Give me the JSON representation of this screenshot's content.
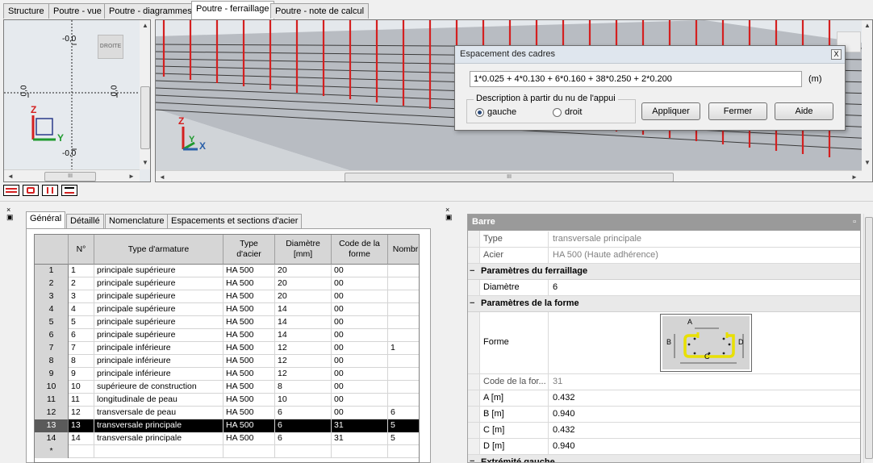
{
  "tabs": [
    "Structure",
    "Poutre - vue",
    "Poutre - diagrammes",
    "Poutre - ferraillage",
    "Poutre - note de calcul"
  ],
  "active_tab_index": 3,
  "left_view": {
    "view_cube_label": "DROITE",
    "scale_top": "-0,0",
    "scale_bottom": "-0,0",
    "scale_left": "0,0",
    "scale_right": "0,0",
    "axis_z": "Z",
    "axis_y": "Y"
  },
  "main_view": {
    "axis_z": "Z",
    "axis_y": "Y",
    "axis_x": "X"
  },
  "dialog": {
    "title": "Espacement des cadres",
    "close_label": "X",
    "formula": "1*0.025 + 4*0.130 + 6*0.160 + 38*0.250 + 2*0.200",
    "unit": "(m)",
    "group_label": "Description à partir du nu de l'appui",
    "radio_left": "gauche",
    "radio_right": "droit",
    "selected_radio": "gauche",
    "btn_apply": "Appliquer",
    "btn_close": "Fermer",
    "btn_help": "Aide"
  },
  "panel_tabs": [
    "Général",
    "Détaillé",
    "Nomenclature",
    "Espacements et sections d'acier"
  ],
  "grid": {
    "headers": [
      "N°",
      "Type d'armature",
      "Type\nd'acier",
      "Diamètre\n[mm]",
      "Code de la\nforme",
      "Nombr"
    ],
    "rows": [
      [
        "1",
        "1",
        "principale supérieure",
        "HA 500",
        "20",
        "00",
        ""
      ],
      [
        "2",
        "2",
        "principale supérieure",
        "HA 500",
        "20",
        "00",
        ""
      ],
      [
        "3",
        "3",
        "principale supérieure",
        "HA 500",
        "20",
        "00",
        ""
      ],
      [
        "4",
        "4",
        "principale supérieure",
        "HA 500",
        "14",
        "00",
        ""
      ],
      [
        "5",
        "5",
        "principale supérieure",
        "HA 500",
        "14",
        "00",
        ""
      ],
      [
        "6",
        "6",
        "principale supérieure",
        "HA 500",
        "14",
        "00",
        ""
      ],
      [
        "7",
        "7",
        "principale inférieure",
        "HA 500",
        "12",
        "00",
        "1"
      ],
      [
        "8",
        "8",
        "principale inférieure",
        "HA 500",
        "12",
        "00",
        ""
      ],
      [
        "9",
        "9",
        "principale inférieure",
        "HA 500",
        "12",
        "00",
        ""
      ],
      [
        "10",
        "10",
        "supérieure de construction",
        "HA 500",
        "8",
        "00",
        ""
      ],
      [
        "11",
        "11",
        "longitudinale de peau",
        "HA 500",
        "10",
        "00",
        ""
      ],
      [
        "12",
        "12",
        "transversale de peau",
        "HA 500",
        "6",
        "00",
        "6"
      ],
      [
        "13",
        "13",
        "transversale principale",
        "HA 500",
        "6",
        "31",
        "5"
      ],
      [
        "14",
        "14",
        "transversale principale",
        "HA 500",
        "6",
        "31",
        "5"
      ],
      [
        "*",
        "",
        "",
        "",
        "",
        "",
        ""
      ]
    ],
    "selected_row": 13
  },
  "properties": {
    "title": "Barre",
    "type_label": "Type",
    "type_value": "transversale principale",
    "acier_label": "Acier",
    "acier_value": "HA 500 (Haute adhérence)",
    "section_ferraillage": "Paramètres du ferraillage",
    "diametre_label": "Diamètre",
    "diametre_value": "6",
    "section_forme": "Paramètres de la forme",
    "forme_label": "Forme",
    "shape_labels": {
      "a": "A",
      "b": "B",
      "c": "C",
      "d": "D"
    },
    "code_label": "Code de la for...",
    "code_value": "31",
    "a_label": "A [m]",
    "a_value": "0.432",
    "b_label": "B [m]",
    "b_value": "0.940",
    "c_label": "C [m]",
    "c_value": "0.432",
    "d_label": "D [m]",
    "d_value": "0.940",
    "section_extremite": "Extrémité gauche"
  },
  "colors": {
    "rebar": "#d42020",
    "shape_yellow": "#e8e000",
    "accent": "#2a5fa8"
  }
}
